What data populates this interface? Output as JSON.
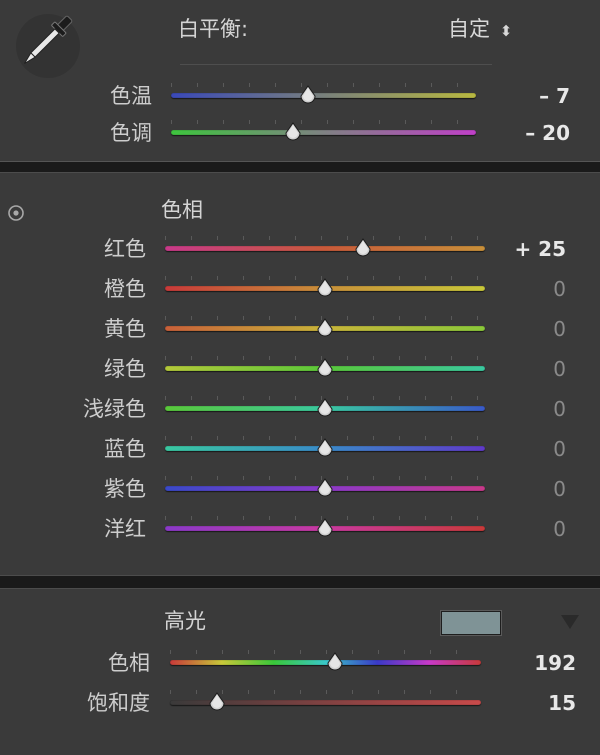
{
  "white_balance": {
    "title": "白平衡:",
    "mode": "自定",
    "mode_arrow": "⬍",
    "sliders": [
      {
        "label": "色温",
        "value_text": "– 7",
        "position": 0.45,
        "gradient": [
          "#3a49b8",
          "#b8b840"
        ]
      },
      {
        "label": "色调",
        "value_text": "– 20",
        "position": 0.4,
        "gradient": [
          "#3ec43e",
          "#c040c8"
        ]
      }
    ]
  },
  "hue": {
    "title": "色相",
    "sliders": [
      {
        "label": "红色",
        "value_text": "+ 25",
        "position": 0.62,
        "gradient": [
          "#c83a8a",
          "#c85a3a",
          "#c8903a"
        ]
      },
      {
        "label": "橙色",
        "value_text": "0",
        "position": 0.5,
        "gradient": [
          "#c83a3a",
          "#c8903a",
          "#c8c83a"
        ]
      },
      {
        "label": "黄色",
        "value_text": "0",
        "position": 0.5,
        "gradient": [
          "#c8603a",
          "#c8b43a",
          "#8ac83a"
        ]
      },
      {
        "label": "绿色",
        "value_text": "0",
        "position": 0.5,
        "gradient": [
          "#b4c83a",
          "#5ac83a",
          "#3ac8a0"
        ]
      },
      {
        "label": "浅绿色",
        "value_text": "0",
        "position": 0.5,
        "gradient": [
          "#5ac83a",
          "#3ac8a0",
          "#3a5ac8"
        ]
      },
      {
        "label": "蓝色",
        "value_text": "0",
        "position": 0.5,
        "gradient": [
          "#3ac8a0",
          "#3a8ac8",
          "#603ac8"
        ]
      },
      {
        "label": "紫色",
        "value_text": "0",
        "position": 0.5,
        "gradient": [
          "#3a4ac8",
          "#8a3ac8",
          "#c83a8a"
        ]
      },
      {
        "label": "洋红",
        "value_text": "0",
        "position": 0.5,
        "gradient": [
          "#8a3ac8",
          "#c83aa0",
          "#c83a3a"
        ]
      }
    ]
  },
  "highlights": {
    "title": "高光",
    "swatch_color": "#7f9396",
    "sliders": [
      {
        "label": "色相",
        "value_text": "192",
        "position": 0.53,
        "gradient": [
          "#c83a3a",
          "#c8c83a",
          "#3ac83a",
          "#3ac8c8",
          "#3a3ac8",
          "#c83ac8",
          "#c83a3a"
        ]
      },
      {
        "label": "饱和度",
        "value_text": "15",
        "position": 0.15,
        "gradient": [
          "#3a3a3a",
          "#c84a4a"
        ]
      }
    ]
  },
  "icons": {
    "eyedropper": "eyedropper-icon",
    "target": "target-adjust-icon",
    "collapse": "triangle-down-icon"
  }
}
